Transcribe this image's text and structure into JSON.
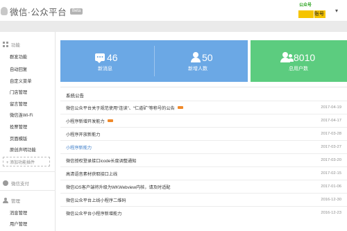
{
  "header": {
    "brand": "微信·公众平台",
    "beta": "Beta",
    "avatar_text": "公众号",
    "account_name": "账号",
    "caret": "▾"
  },
  "sidebar": {
    "sections": [
      {
        "label": "功能",
        "icon": "grid-icon",
        "items": [
          "群发功能",
          "自动回复",
          "自定义菜单",
          "门店管理",
          "留言管理",
          "微信连Wi-Fi",
          "投票管理",
          "页面模版",
          "原创声明功能"
        ]
      },
      {
        "label": "微信支付",
        "icon": "wechat-pay-icon",
        "items": []
      },
      {
        "label": "管理",
        "icon": "user-icon",
        "items": [
          "消息管理",
          "用户管理"
        ]
      }
    ],
    "add_plugin": "+ 添加功能插件"
  },
  "stats": [
    {
      "value": "46",
      "label": "新消息",
      "icon": "message-icon"
    },
    {
      "value": "50",
      "label": "新增人数",
      "icon": "user-icon"
    },
    {
      "value": "8010",
      "label": "总用户数",
      "icon": "users-icon"
    }
  ],
  "notices": {
    "title": "系统公告",
    "items": [
      {
        "title": "微信公众平台关于规范使用“连读”、“仁道矿”等称号的公告",
        "date": "2017-04-19",
        "badge": true,
        "link": false
      },
      {
        "title": "小程序新增开发能力",
        "date": "2017-04-17",
        "badge": true,
        "link": false
      },
      {
        "title": "小程序开放新能力",
        "date": "2017-03-28",
        "badge": false,
        "link": false
      },
      {
        "title": "小程序新能力",
        "date": "2017-03-27",
        "badge": false,
        "link": true
      },
      {
        "title": "微信授权登录接口icode长度调整通知",
        "date": "2017-03-20",
        "badge": false,
        "link": false
      },
      {
        "title": "高清语音素材获取接口上线",
        "date": "2017-02-15",
        "badge": false,
        "link": false
      },
      {
        "title": "微信iOS客户端将升级为WKWebview内核，请及时适配",
        "date": "2017-01-06",
        "badge": false,
        "link": false
      },
      {
        "title": "微信公众平台上线小程序二维码",
        "date": "2016-12-30",
        "badge": false,
        "link": false
      },
      {
        "title": "微信公众平台小程序新增能力",
        "date": "2016-12-23",
        "badge": false,
        "link": false
      }
    ]
  },
  "colors": {
    "stat_blue": "#6ba8e5",
    "stat_green": "#5ccc7f",
    "new_badge": "#f08a2b",
    "link": "#3e7ec9"
  }
}
